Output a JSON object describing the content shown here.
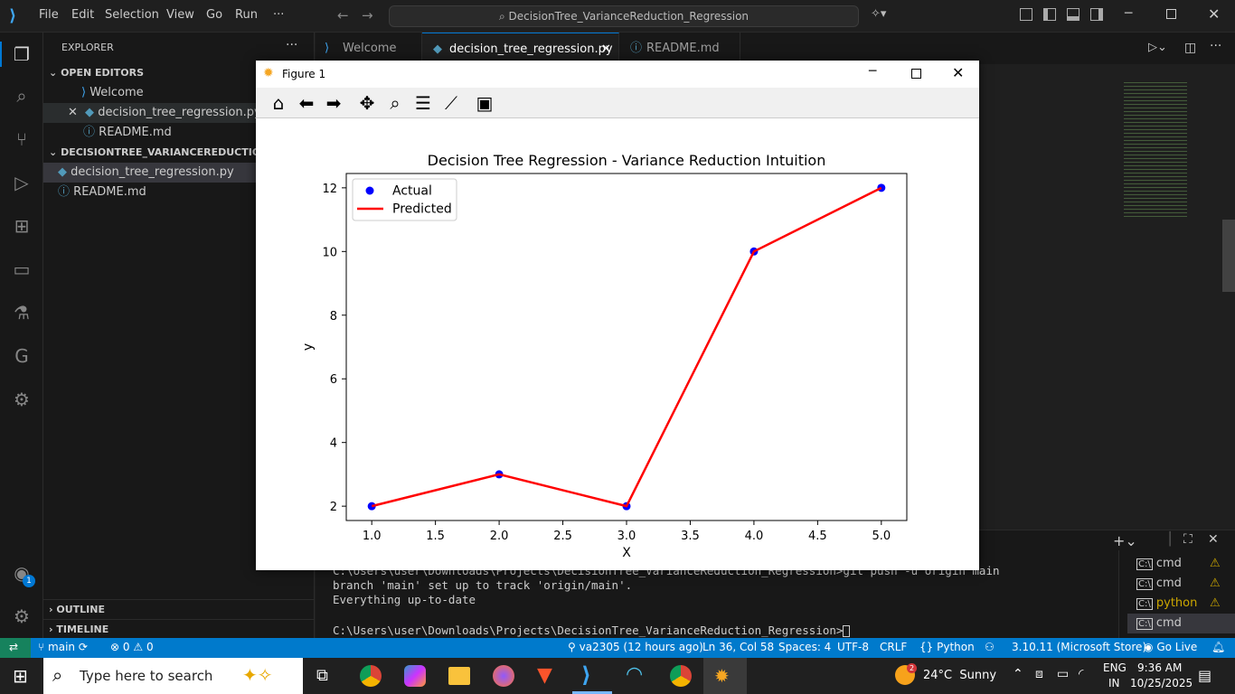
{
  "menu": [
    "File",
    "Edit",
    "Selection",
    "View",
    "Go",
    "Run",
    "···"
  ],
  "command_center": "DecisionTree_VarianceReduction_Regression",
  "sidebar": {
    "title": "EXPLORER",
    "open_editors_label": "OPEN EDITORS",
    "open_editors": [
      "Welcome",
      "decision_tree_regression.py",
      "README.md"
    ],
    "folder_label": "DECISIONTREE_VARIANCEREDUCTION_RE...",
    "files": [
      "decision_tree_regression.py",
      "README.md"
    ],
    "outline_label": "OUTLINE",
    "timeline_label": "TIMELINE"
  },
  "tabs": [
    "Welcome",
    "decision_tree_regression.py",
    "README.md"
  ],
  "terminal": {
    "lines": [
      "C:\\Users\\user\\Downloads\\Projects\\DecisionTree_VarianceReduction_Regression>git push -u origin main",
      "branch 'main' set up to track 'origin/main'.",
      "Everything up-to-date",
      "",
      "C:\\Users\\user\\Downloads\\Projects\\DecisionTree_VarianceReduction_Regression>"
    ],
    "sessions": [
      "cmd",
      "cmd",
      "python",
      "cmd"
    ]
  },
  "status": {
    "branch": "main",
    "problems": "0",
    "warnings": "0",
    "commit": "va2305 (12 hours ago)",
    "position": "Ln 36, Col 58",
    "spaces": "Spaces: 4",
    "encoding": "UTF-8",
    "eol": "CRLF",
    "language": "Python",
    "interpreter": "3.10.11 (Microsoft Store)",
    "golive": "Go Live"
  },
  "taskbar": {
    "search_placeholder": "Type here to search",
    "weather": "24°C  Sunny",
    "lang1": "ENG",
    "lang2": "IN",
    "time": "9:36 AM",
    "date": "10/25/2025",
    "weather_badge": "2"
  },
  "figure": {
    "window_title": "Figure 1",
    "accounts_badge": "1"
  },
  "chart_data": {
    "type": "line",
    "title": "Decision Tree Regression - Variance Reduction Intuition",
    "xlabel": "X",
    "ylabel": "y",
    "xlim": [
      0.8,
      5.2
    ],
    "ylim": [
      1.55,
      12.45
    ],
    "xticks": [
      1.0,
      1.5,
      2.0,
      2.5,
      3.0,
      3.5,
      4.0,
      4.5,
      5.0
    ],
    "xtick_labels": [
      "1.0",
      "1.5",
      "2.0",
      "2.5",
      "3.0",
      "3.5",
      "4.0",
      "4.5",
      "5.0"
    ],
    "yticks": [
      2,
      4,
      6,
      8,
      10,
      12
    ],
    "ytick_labels": [
      "2",
      "4",
      "6",
      "8",
      "10",
      "12"
    ],
    "legend": "top-left",
    "series": [
      {
        "name": "Actual",
        "kind": "scatter",
        "color": "#0000ff",
        "x": [
          1,
          2,
          3,
          4,
          5
        ],
        "y": [
          2,
          3,
          2,
          10,
          12
        ]
      },
      {
        "name": "Predicted",
        "kind": "line",
        "color": "#ff0000",
        "x": [
          1,
          2,
          3,
          4,
          5
        ],
        "y": [
          2,
          3,
          2,
          10,
          12
        ]
      }
    ]
  }
}
